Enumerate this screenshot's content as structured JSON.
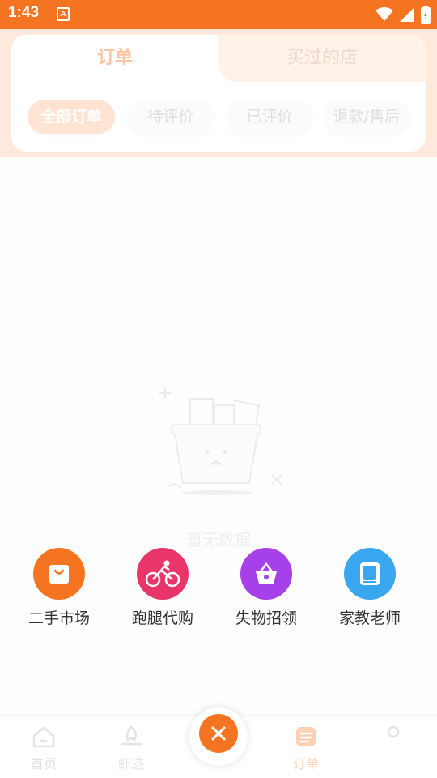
{
  "status_bar": {
    "time": "1:43",
    "notification_letter": "A"
  },
  "tabs": [
    {
      "label": "订单",
      "active": true
    },
    {
      "label": "买过的店",
      "active": false
    }
  ],
  "filter_chips": [
    {
      "label": "全部订单",
      "active": true
    },
    {
      "label": "待评价",
      "active": false
    },
    {
      "label": "已评价",
      "active": false
    },
    {
      "label": "退款/售后",
      "active": false
    }
  ],
  "empty_state": {
    "text": "暂无数据"
  },
  "quick_menu": [
    {
      "label": "二手市场",
      "icon": "shopping-bag-icon",
      "color": "#f47421"
    },
    {
      "label": "跑腿代购",
      "icon": "cyclist-icon",
      "color": "#e8356a"
    },
    {
      "label": "失物招领",
      "icon": "basket-icon",
      "color": "#a640e8"
    },
    {
      "label": "家教老师",
      "icon": "book-icon",
      "color": "#3aa6f0"
    }
  ],
  "bottom_nav": [
    {
      "label": "首页",
      "icon": "home-icon",
      "active": false
    },
    {
      "label": "虾迹",
      "icon": "flame-icon",
      "active": false
    },
    {
      "label": "订单",
      "icon": "orders-icon",
      "active": true
    },
    {
      "label": "",
      "icon": "profile-icon",
      "active": false
    }
  ],
  "center_button": {
    "icon": "close-icon"
  },
  "colors": {
    "accent": "#f47421",
    "header_bg": "#ffe9dc"
  }
}
